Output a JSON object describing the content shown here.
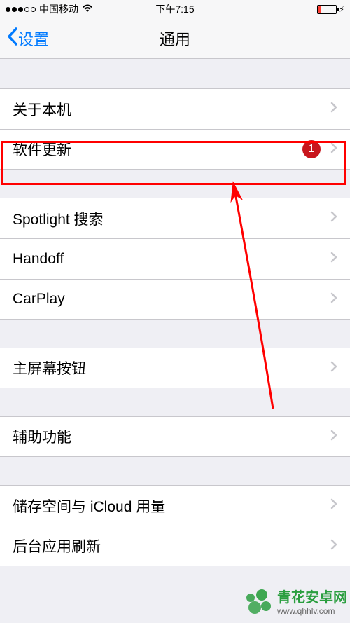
{
  "statusBar": {
    "carrier": "中国移动",
    "time": "下午7:15"
  },
  "nav": {
    "back_label": "设置",
    "title": "通用"
  },
  "sections": [
    {
      "rows": [
        {
          "label": "关于本机",
          "badge": null
        },
        {
          "label": "软件更新",
          "badge": "1"
        }
      ]
    },
    {
      "rows": [
        {
          "label": "Spotlight 搜索",
          "badge": null
        },
        {
          "label": "Handoff",
          "badge": null
        },
        {
          "label": "CarPlay",
          "badge": null
        }
      ]
    },
    {
      "rows": [
        {
          "label": "主屏幕按钮",
          "badge": null
        }
      ]
    },
    {
      "rows": [
        {
          "label": "辅助功能",
          "badge": null
        }
      ]
    },
    {
      "rows": [
        {
          "label": "储存空间与 iCloud 用量",
          "badge": null
        },
        {
          "label": "后台应用刷新",
          "badge": null
        }
      ]
    }
  ],
  "watermark": {
    "title": "青花安卓网",
    "url": "www.qhhlv.com"
  },
  "colors": {
    "accent": "#007aff",
    "badge": "#c8161d",
    "highlight": "#ff0000",
    "watermark_brand": "#2a9e3f"
  }
}
